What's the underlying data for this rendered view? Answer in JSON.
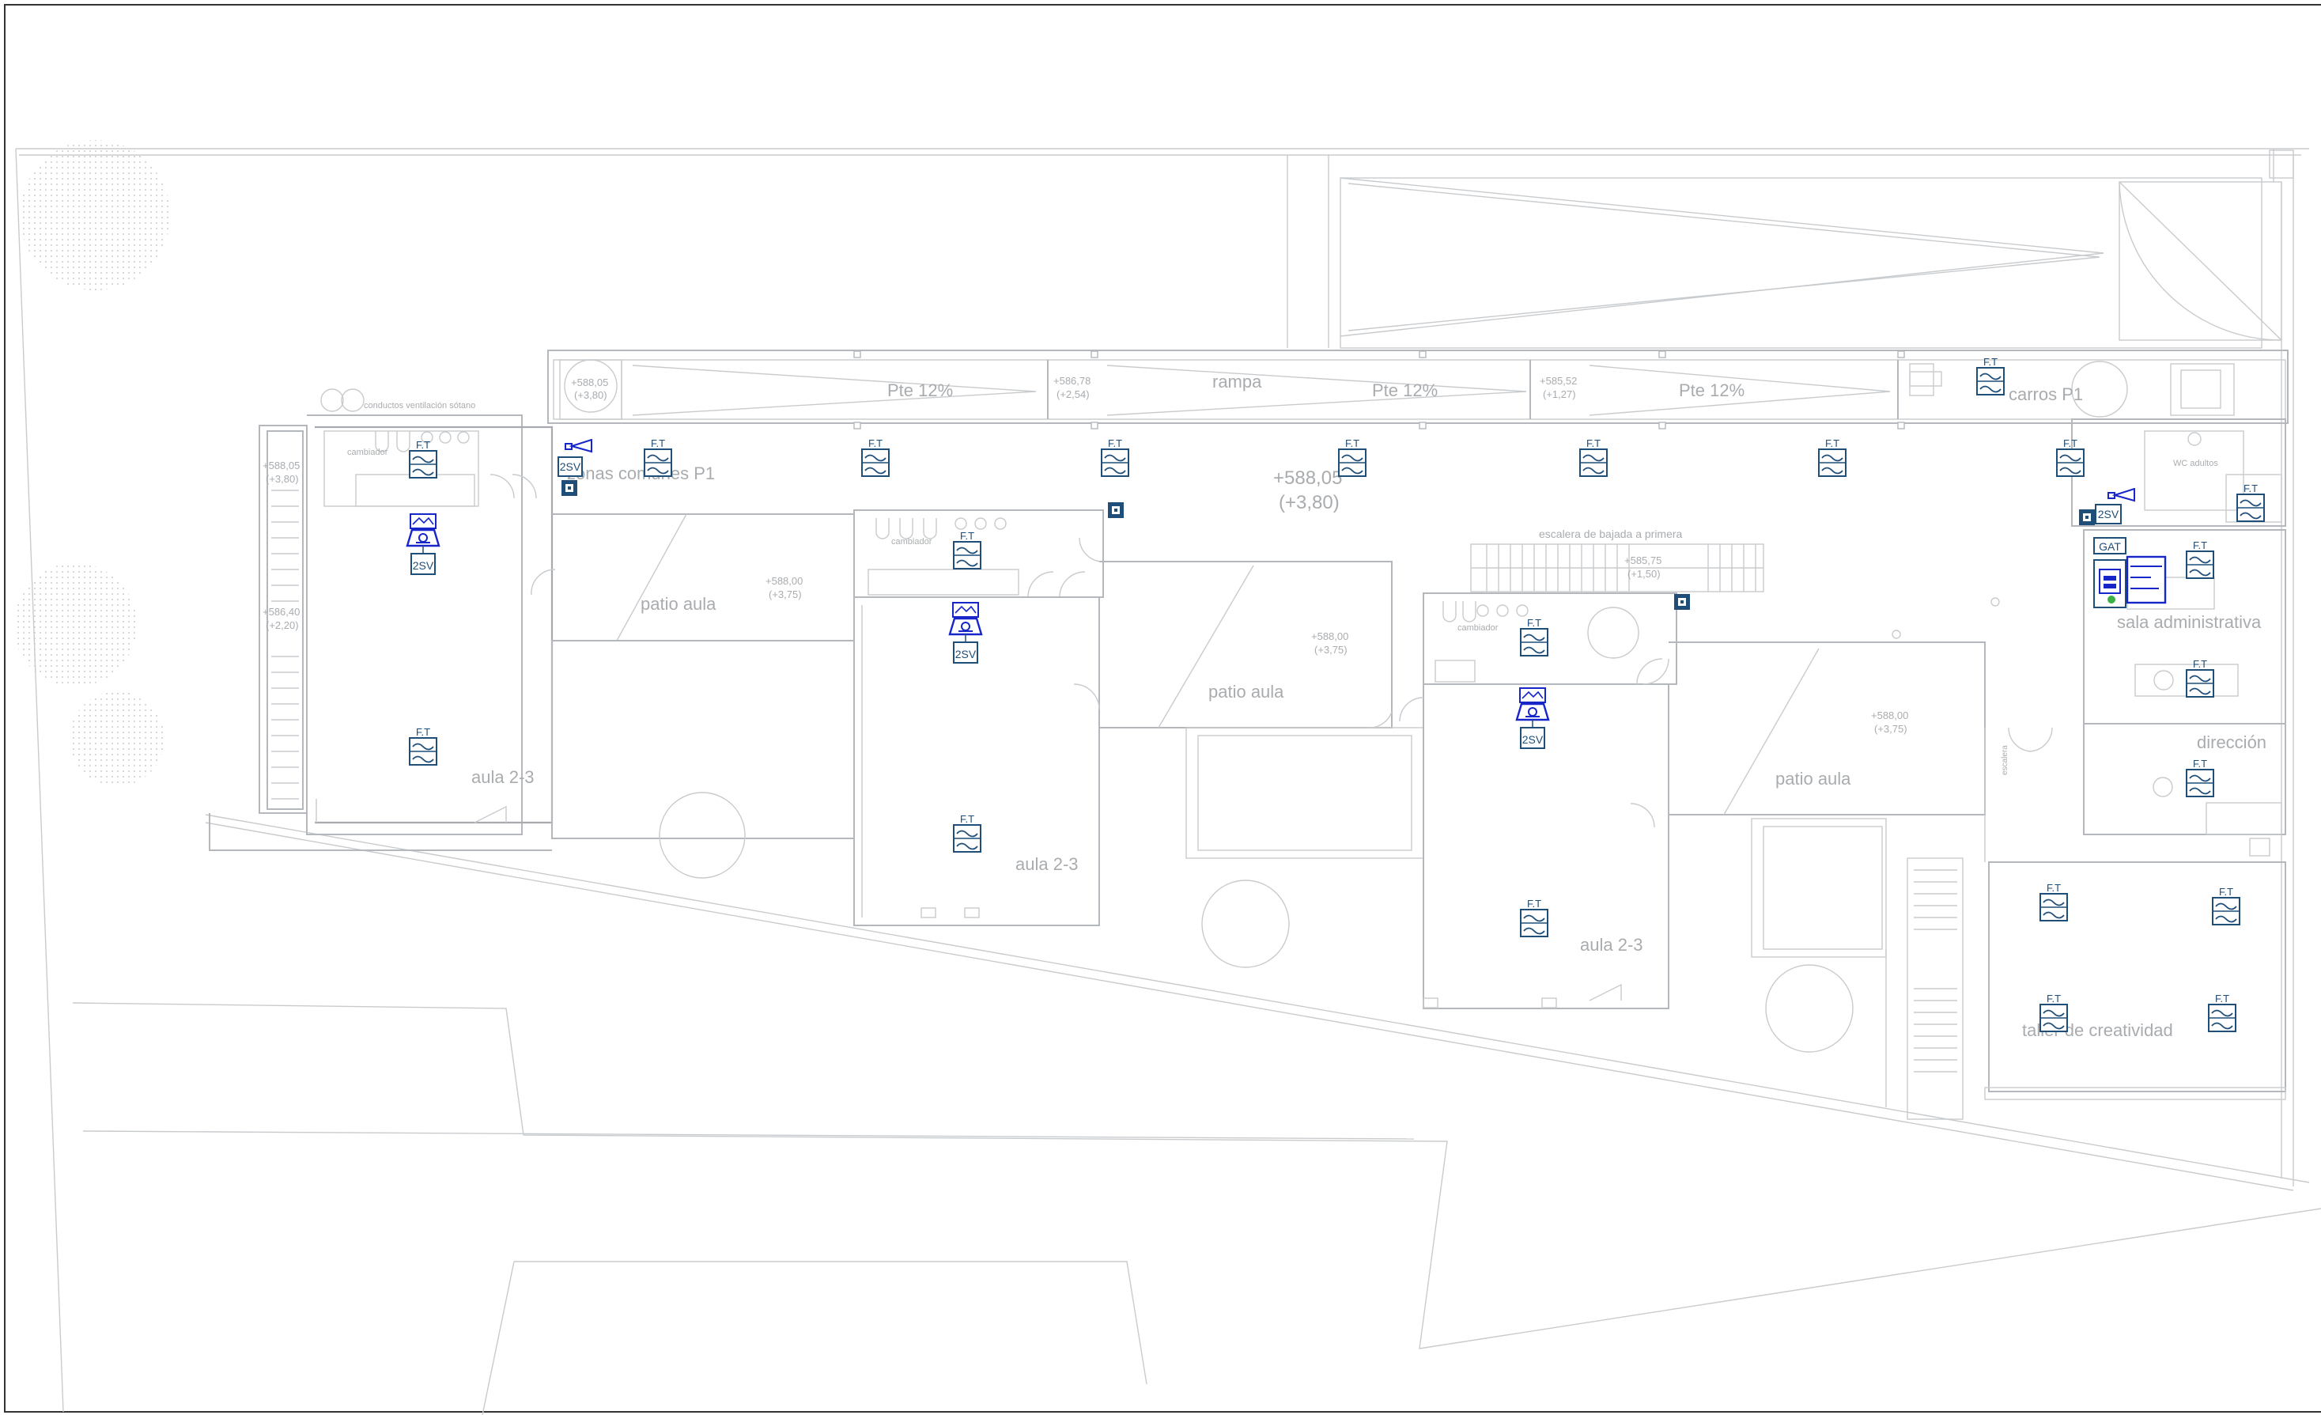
{
  "rooms": {
    "aula_1": "aula 2-3",
    "aula_2": "aula 2-3",
    "aula_3": "aula 2-3",
    "patio_1": "patio aula",
    "patio_2": "patio aula",
    "patio_3": "patio aula",
    "sala_admin": "sala administrativa",
    "direccion": "dirección",
    "taller": "taller de creatividad",
    "zonas_comunes": "zonas comunes P1",
    "rampa": "rampa",
    "escalera_tramo": "escalera de bajada a primera",
    "carros": "carros P1",
    "wc": "WC adultos",
    "cambiador_1": "cambiador",
    "cambiador_2": "cambiador",
    "cambiador_3": "cambiador",
    "conductos": "conductos ventilación sótano",
    "escalera_vertical": "escalera"
  },
  "slopes": [
    "Pte 12%",
    "Pte 12%",
    "Pte 12%"
  ],
  "levels": {
    "main": [
      "+588,05",
      "(+3,80)"
    ],
    "ramp_start": [
      "+588,05",
      "(+3,80)"
    ],
    "ramp_mid": [
      "+586,78",
      "(+2,54)"
    ],
    "ramp_end": [
      "+585,52",
      "(+1,27)"
    ],
    "stair_top": [
      "+588,05",
      "(+3,80)"
    ],
    "stair_mid": [
      "+586,40",
      "(+2,20)"
    ],
    "patio_1": [
      "+588,00",
      "(+3,75)"
    ],
    "patio_2": [
      "+588,00",
      "(+3,75)"
    ],
    "patio_3": [
      "+588,00",
      "(+3,75)"
    ],
    "stair_land": [
      "+585,75",
      "(+1,50)"
    ]
  },
  "symbols": {
    "ft_label": "F.T",
    "sv_label": "2SV",
    "gat_label": "GAT"
  },
  "colors": {
    "symbol": "#1f4e79",
    "symbol_accent": "#1726c9",
    "walls": "#b4b8bc",
    "labels": "#a9acaf",
    "status_dot": "#3cb043"
  },
  "icons": {
    "ft": "telecom-outlet-icon",
    "sv": "signal-splitter-icon",
    "antenna": "antenna-icon",
    "socket": "wall-socket-icon",
    "gat": "telecom-cabinet-icon"
  }
}
